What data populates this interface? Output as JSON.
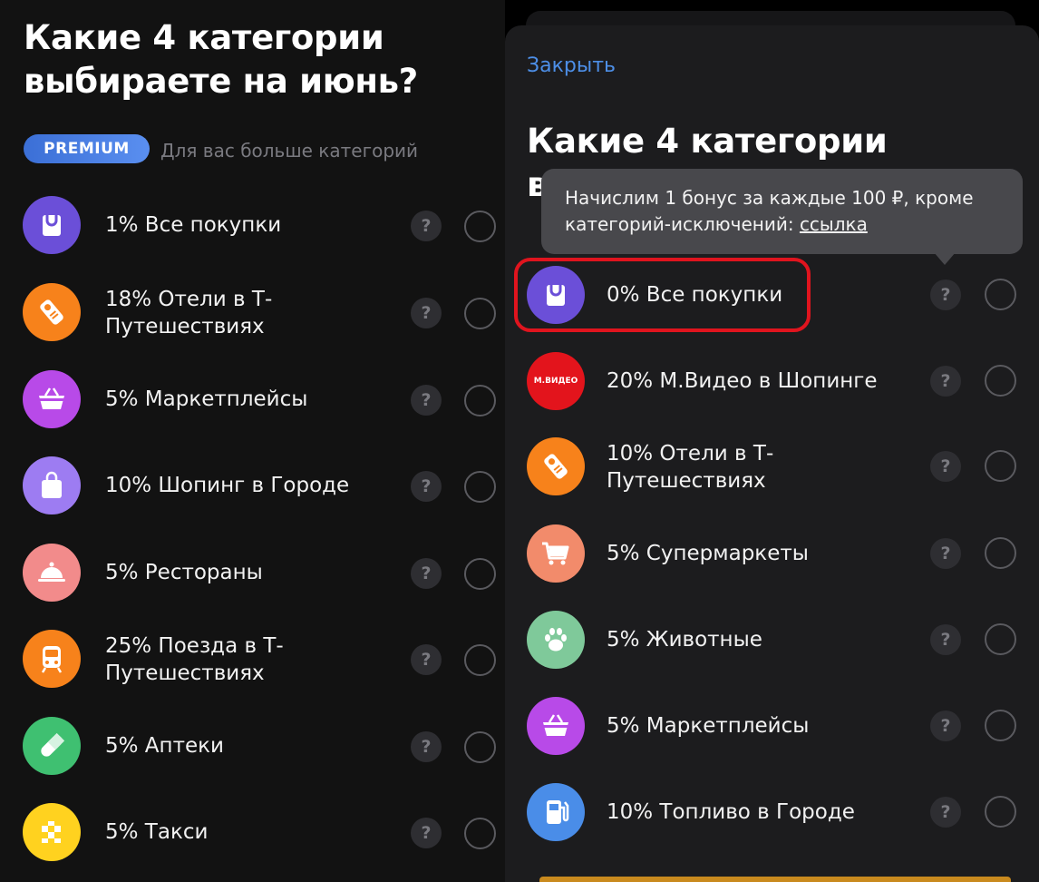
{
  "left_panel": {
    "title": "Какие 4 категории выбираете на июнь?",
    "premium_badge": "PREMIUM",
    "premium_subtitle": "Для вас больше категорий",
    "help_symbol": "?",
    "items": [
      {
        "label": "1% Все покупки",
        "icon": "shopping-bag-icon",
        "color": "#6b4fd8"
      },
      {
        "label": "18% Отели в Т-Путешествиях",
        "icon": "door-hanger-icon",
        "color": "#f7821b"
      },
      {
        "label": "5% Маркетплейсы",
        "icon": "basket-icon",
        "color": "#b84ae8"
      },
      {
        "label": "10% Шопинг в Городе",
        "icon": "shopping-bag-icon",
        "color": "#9d7cf2"
      },
      {
        "label": "5% Рестораны",
        "icon": "cloche-icon",
        "color": "#f28b8b"
      },
      {
        "label": "25% Поезда в Т-Путешествиях",
        "icon": "train-icon",
        "color": "#f7821b"
      },
      {
        "label": "5% Аптеки",
        "icon": "pill-icon",
        "color": "#3fc071"
      },
      {
        "label": "5% Такси",
        "icon": "taxi-checker-icon",
        "color": "#ffd21f"
      }
    ]
  },
  "right_panel": {
    "close_label": "Закрыть",
    "title": "Какие 4 категории",
    "title_peek": "в",
    "tooltip_text": "Начислим 1 бонус за каждые 100 ₽, кроме категорий-исключений: ",
    "tooltip_link": "ссылка",
    "help_symbol": "?",
    "mvideo_logo_text": "М.ВИДЕО",
    "items": [
      {
        "label": "0% Все покупки",
        "icon": "shopping-bag-icon",
        "color": "#6b4fd8",
        "highlighted": true
      },
      {
        "label": "20% М.Видео в Шопинге",
        "icon": "mvideo-logo-icon",
        "color": "#e3141c"
      },
      {
        "label": "10% Отели в Т-Путешествиях",
        "icon": "door-hanger-icon",
        "color": "#f7821b"
      },
      {
        "label": "5% Супермаркеты",
        "icon": "shopping-cart-icon",
        "color": "#f28b6b"
      },
      {
        "label": "5% Животные",
        "icon": "paw-icon",
        "color": "#7fc99a"
      },
      {
        "label": "5% Маркетплейсы",
        "icon": "basket-icon",
        "color": "#b84ae8"
      },
      {
        "label": "10% Топливо в Городе",
        "icon": "fuel-pump-icon",
        "color": "#4a8de8"
      }
    ]
  },
  "colors": {
    "accent_link": "#4d8fe8",
    "highlight_border": "#e0141e",
    "premium_badge": "#4a7de0"
  }
}
